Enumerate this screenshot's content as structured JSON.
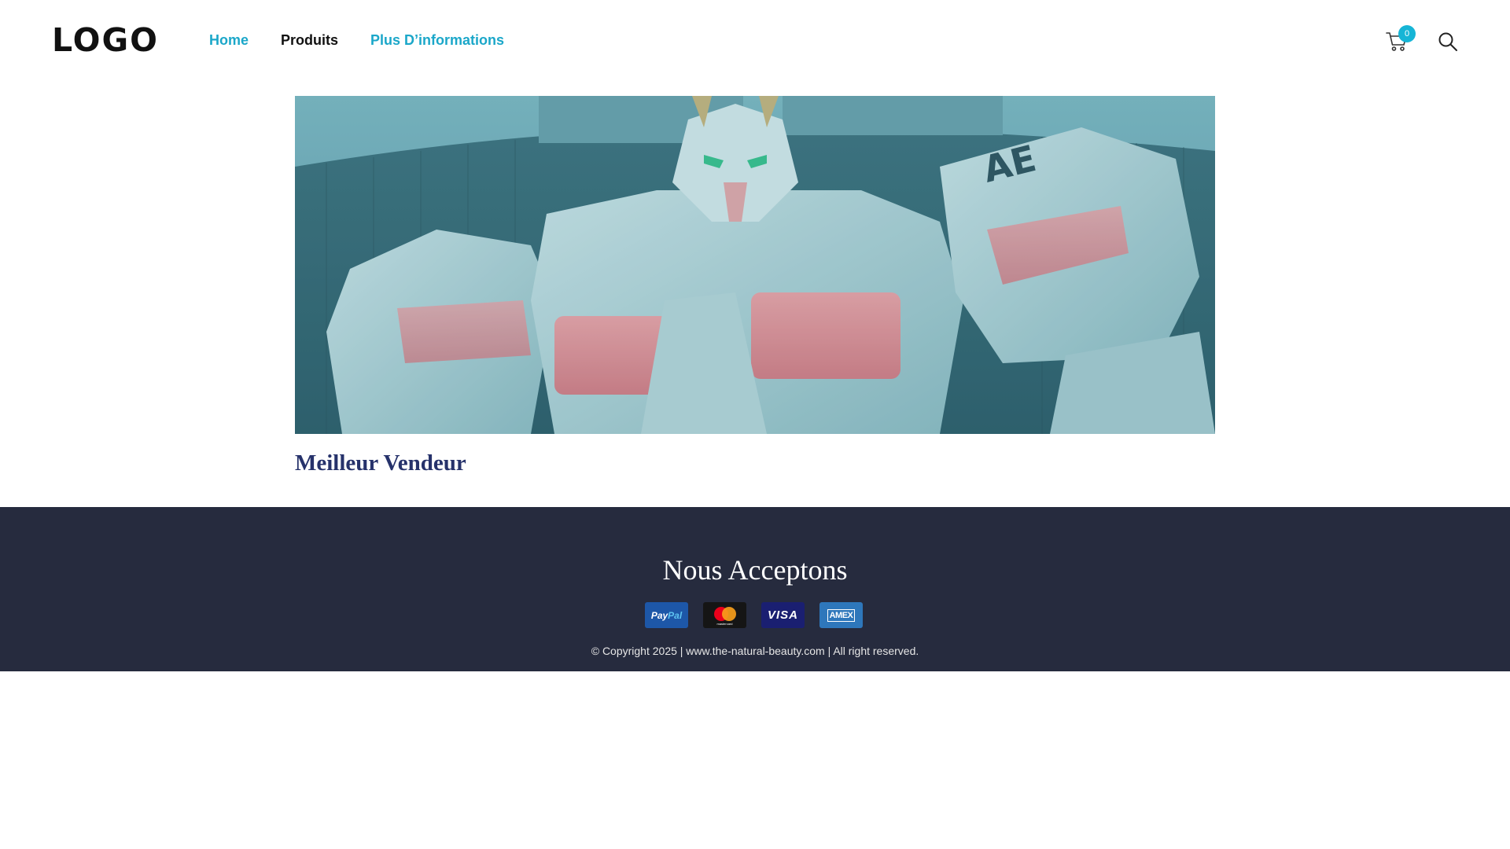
{
  "header": {
    "logo": "LOGO",
    "nav": [
      {
        "label": "Home"
      },
      {
        "label": "Produits"
      },
      {
        "label": "Plus D’informations"
      }
    ],
    "cart_count": "0",
    "icons": {
      "cart": "cart-icon",
      "search": "search-icon"
    }
  },
  "main": {
    "hero_image": "robot-statue-banner",
    "section_title": "Meilleur Vendeur"
  },
  "footer": {
    "title": "Nous Acceptons",
    "payments": {
      "paypal": {
        "pay": "Pay",
        "pal": "Pal"
      },
      "mastercard": "mastercard",
      "visa": "VISA",
      "amex": "AMEX"
    },
    "copyright": "© Copyright 2025 | www.the-natural-beauty.com | All right reserved."
  },
  "colors": {
    "accent": "#1ba7c9",
    "footer_bg": "#262b3e",
    "title_navy": "#26326b",
    "badge": "#16b5d6"
  }
}
